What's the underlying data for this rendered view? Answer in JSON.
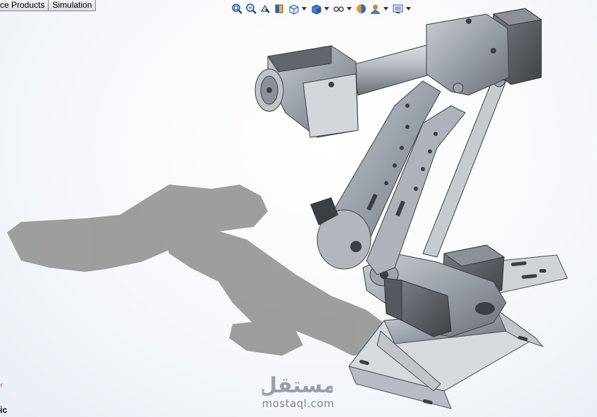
{
  "tabs": [
    {
      "label": "ce Products"
    },
    {
      "label": "Simulation"
    }
  ],
  "hud_toolbar": {
    "icons": [
      {
        "name": "zoom-to-fit-icon",
        "dropdown": false
      },
      {
        "name": "zoom-to-area-icon",
        "dropdown": false
      },
      {
        "name": "previous-view-icon",
        "dropdown": false
      },
      {
        "name": "section-view-icon",
        "dropdown": false
      },
      {
        "name": "view-orientation-icon",
        "dropdown": true
      },
      {
        "name": "display-style-icon",
        "dropdown": true
      },
      {
        "name": "hide-show-items-icon",
        "dropdown": true
      },
      {
        "name": "edit-appearance-icon",
        "dropdown": false
      },
      {
        "name": "apply-scene-icon",
        "dropdown": true
      },
      {
        "name": "view-settings-icon",
        "dropdown": true
      }
    ]
  },
  "fragments": {
    "bottom_left_text": "ic",
    "arrow": "‹"
  },
  "watermark": {
    "logo_text": "مستقل",
    "domain": "mostaql.com"
  },
  "colors": {
    "viewport_bg": "#f3f6fa",
    "metal": "#9ea4ab",
    "metal_dark": "#4d5157",
    "shadow": "#8c8c8c",
    "servo": "#5e6167"
  }
}
